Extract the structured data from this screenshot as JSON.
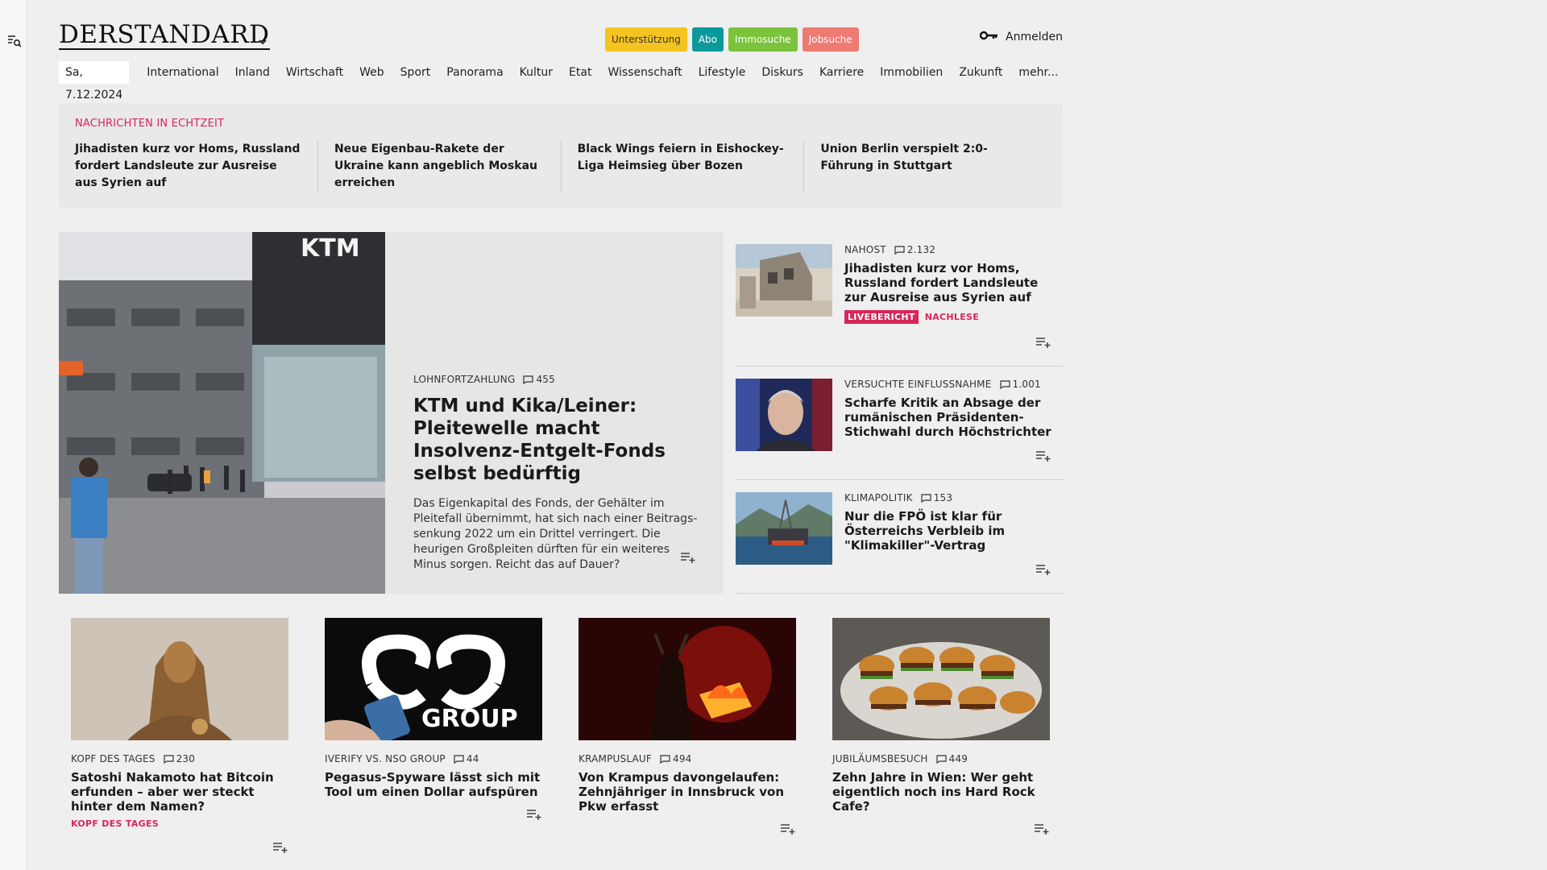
{
  "header": {
    "logo": "DERSTANDARD",
    "pills": [
      {
        "label": "Unterstützung",
        "bg": "#f6c421",
        "fg": "#333333"
      },
      {
        "label": "Abo",
        "bg": "#0b9a9a",
        "fg": "#ffffff"
      },
      {
        "label": "Immosuche",
        "bg": "#7cc33c",
        "fg": "#ffffff"
      },
      {
        "label": "Jobsuche",
        "bg": "#ee7a72",
        "fg": "#ffffff"
      }
    ],
    "login_label": "Anmelden"
  },
  "nav": {
    "date": "Sa, 7.12.2024",
    "items": [
      "International",
      "Inland",
      "Wirtschaft",
      "Web",
      "Sport",
      "Panorama",
      "Kultur",
      "Etat",
      "Wissenschaft",
      "Lifestyle",
      "Diskurs",
      "Karriere",
      "Immobilien",
      "Zukunft",
      "mehr..."
    ]
  },
  "ticker": {
    "title": "NACHRICHTEN IN ECHTZEIT",
    "items": [
      "Jihadisten kurz vor Homs, Russland fordert Landsleute zur Ausreise aus Syrien auf",
      "Neue Eigenbau-Rakete der Ukraine kann angeblich Moskau erreichen",
      "Black Wings feiern in Eishockey-Liga Heimsieg über Bozen",
      "Union Berlin verspielt 2:0-Führung in Stuttgart"
    ]
  },
  "lead": {
    "kicker": "LOHNFORTZAHLUNG",
    "comments": "455",
    "title": "KTM und Kika/Leiner: Pleitewelle macht Insolvenz-Entgelt-Fonds selbst bedürftig",
    "teaser": "Das Eigenkapital des Fonds, der Gehälter im Pleitefall übernimmt, hat sich nach einer Beitrags­senkung 2022 um ein Drittel verringert. Die heurigen Großpleiten dürften für ein weiteres Minus sorgen. Reicht das auf Dauer?"
  },
  "side": [
    {
      "kicker": "NAHOST",
      "comments": "2.132",
      "title": "Jihadisten kurz vor Homs, Russland fordert Landsleute zur Ausreise aus Syrien auf",
      "tag_live": "LIVEBERICHT",
      "tag_text": "NACHLESE"
    },
    {
      "kicker": "VERSUCHTE EINFLUSSNAHME",
      "comments": "1.001",
      "title": "Scharfe Kritik an Absage der rumänischen Präsidenten-Stich­wahl durch Höchstrichter"
    },
    {
      "kicker": "KLIMAPOLITIK",
      "comments": "153",
      "title": "Nur die FPÖ ist klar für Österreichs Verbleib im \"Klima­killer\"-Vertrag"
    }
  ],
  "cards": [
    {
      "kicker": "KOPF DES TAGES",
      "comments": "230",
      "title": "Satoshi Nakamoto hat Bitcoin erfunden – aber wer steckt hinter dem Namen?",
      "tag": "KOPF DES TAGES"
    },
    {
      "kicker": "IVERIFY VS. NSO GROUP",
      "comments": "44",
      "title": "Pegasus-Spyware lässt sich mit Tool um einen Dollar aufspüren"
    },
    {
      "kicker": "KRAMPUSLAUF",
      "comments": "494",
      "title": "Von Krampus davongelaufen: Zehnjähriger in Innsbruck von Pkw erfasst"
    },
    {
      "kicker": "JUBILÄUMSBESUCH",
      "comments": "449",
      "title": "Zehn Jahre in Wien: Wer geht eigentlich noch ins Hard Rock Cafe?"
    }
  ],
  "ktm_sign": "KTM",
  "nso_sign": "GROUP",
  "accent": "#d8265b"
}
